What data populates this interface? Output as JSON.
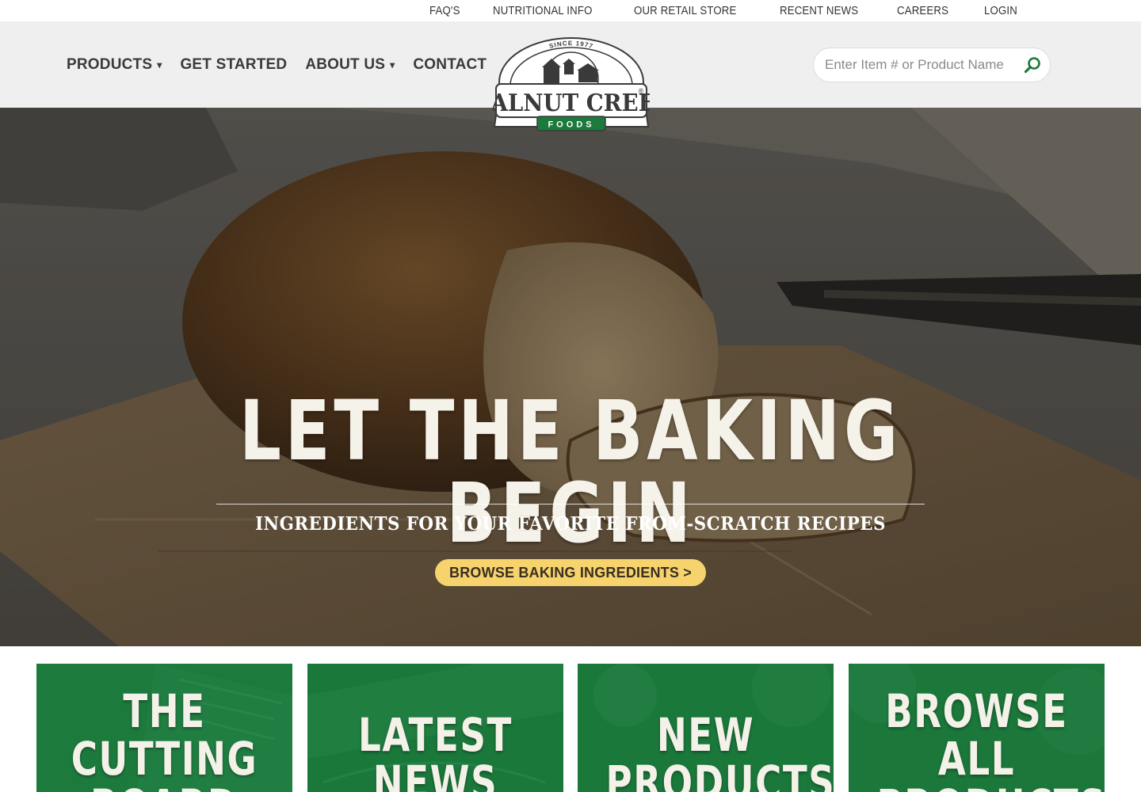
{
  "utility_nav": [
    "FAQ'S",
    "NUTRITIONAL INFO",
    "OUR RETAIL STORE",
    "RECENT NEWS",
    "CAREERS",
    "LOGIN"
  ],
  "main_nav": [
    {
      "label": "PRODUCTS",
      "caret": "▾"
    },
    {
      "label": "GET STARTED",
      "caret": ""
    },
    {
      "label": "ABOUT US",
      "caret": "▾"
    },
    {
      "label": "CONTACT",
      "caret": ""
    }
  ],
  "logo": {
    "since": "SINCE 1977",
    "brand": "WALNUT CREEK",
    "sub": "FOODS",
    "registered": "®"
  },
  "search": {
    "placeholder": "Enter Item # or Product Name",
    "icon": "search-icon"
  },
  "hero": {
    "title": "LET THE BAKING BEGIN",
    "subtitle": "INGREDIENTS FOR YOUR FAVORITE FROM-SCRATCH RECIPES",
    "button_label": "BROWSE BAKING INGREDIENTS >"
  },
  "tiles": [
    {
      "line1": "THE",
      "line2": "CUTTING",
      "line3": "BOARD"
    },
    {
      "line1": "LATEST",
      "line2": "NEWS",
      "line3": ""
    },
    {
      "line1": "NEW",
      "line2": "PRODUCTS",
      "line3": ""
    },
    {
      "line1": "BROWSE",
      "line2": "ALL",
      "line3": "PRODUCTS"
    }
  ],
  "colors": {
    "brand_green": "#1b7a3c",
    "button_yellow": "#f7d36e",
    "header_bg": "#efefef"
  }
}
